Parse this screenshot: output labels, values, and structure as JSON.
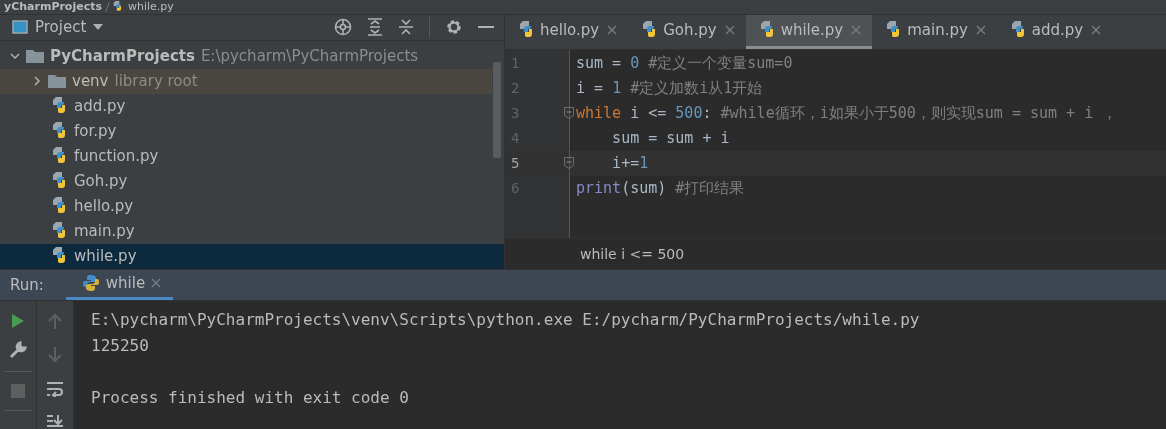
{
  "breadcrumb": {
    "items": [
      "yCharmProjects",
      "while.py"
    ]
  },
  "project_panel": {
    "title": "Project",
    "tree": [
      {
        "name": "PyCharmProjects",
        "kind": "folder",
        "path": "E:\\pycharm\\PyCharmProjects",
        "expanded": true,
        "selected": false,
        "children": [
          {
            "name": "venv",
            "kind": "folder",
            "note": "library root",
            "expanded": false,
            "selected": false
          },
          {
            "name": "add.py",
            "kind": "file",
            "selected": false
          },
          {
            "name": "for.py",
            "kind": "file",
            "selected": false
          },
          {
            "name": "function.py",
            "kind": "file",
            "selected": false
          },
          {
            "name": "Goh.py",
            "kind": "file",
            "selected": false
          },
          {
            "name": "hello.py",
            "kind": "file",
            "selected": false
          },
          {
            "name": "main.py",
            "kind": "file",
            "selected": false
          },
          {
            "name": "while.py",
            "kind": "file",
            "selected": true
          }
        ]
      }
    ]
  },
  "editor": {
    "tabs": [
      {
        "label": "hello.py",
        "selected": false
      },
      {
        "label": "Goh.py",
        "selected": false
      },
      {
        "label": "while.py",
        "selected": true
      },
      {
        "label": "main.py",
        "selected": false
      },
      {
        "label": "add.py",
        "selected": false
      }
    ],
    "lines": [
      {
        "number": "1",
        "current": false,
        "fold": false,
        "tokens": [
          {
            "kind": "plain",
            "text": "sum = "
          },
          {
            "kind": "number",
            "text": "0"
          },
          {
            "kind": "comment",
            "text": " #定义一个变量sum=0"
          }
        ]
      },
      {
        "number": "2",
        "current": false,
        "fold": false,
        "tokens": [
          {
            "kind": "plain",
            "text": "i = "
          },
          {
            "kind": "number",
            "text": "1"
          },
          {
            "kind": "comment",
            "text": " #定义加数i从1开始"
          }
        ]
      },
      {
        "number": "3",
        "current": false,
        "fold": true,
        "tokens": [
          {
            "kind": "keyword",
            "text": "while"
          },
          {
            "kind": "plain",
            "text": " i <= "
          },
          {
            "kind": "number",
            "text": "500"
          },
          {
            "kind": "plain",
            "text": ":"
          },
          {
            "kind": "comment",
            "text": " #while循环，i如果小于500，则实现sum = sum + i ，"
          }
        ]
      },
      {
        "number": "4",
        "current": false,
        "fold": false,
        "tokens": [
          {
            "kind": "plain",
            "text": "    sum = sum + i"
          }
        ]
      },
      {
        "number": "5",
        "current": true,
        "fold": true,
        "tokens": [
          {
            "kind": "plain",
            "text": "    i+="
          },
          {
            "kind": "number",
            "text": "1"
          }
        ]
      },
      {
        "number": "6",
        "current": false,
        "fold": false,
        "tokens": [
          {
            "kind": "builtin",
            "text": "print"
          },
          {
            "kind": "plain",
            "text": "(sum)"
          },
          {
            "kind": "comment",
            "text": " #打印结果"
          }
        ]
      }
    ],
    "context": "while i <= 500"
  },
  "run_panel": {
    "label": "Run:",
    "tabs": [
      {
        "label": "while",
        "selected": true
      }
    ],
    "console": [
      {
        "kind": "command",
        "text": "E:\\pycharm\\PyCharmProjects\\venv\\Scripts\\python.exe E:/pycharm/PyCharmProjects/while.py"
      },
      {
        "kind": "output",
        "text": "125250"
      },
      {
        "kind": "exit",
        "text": "Process finished with exit code 0"
      }
    ]
  }
}
